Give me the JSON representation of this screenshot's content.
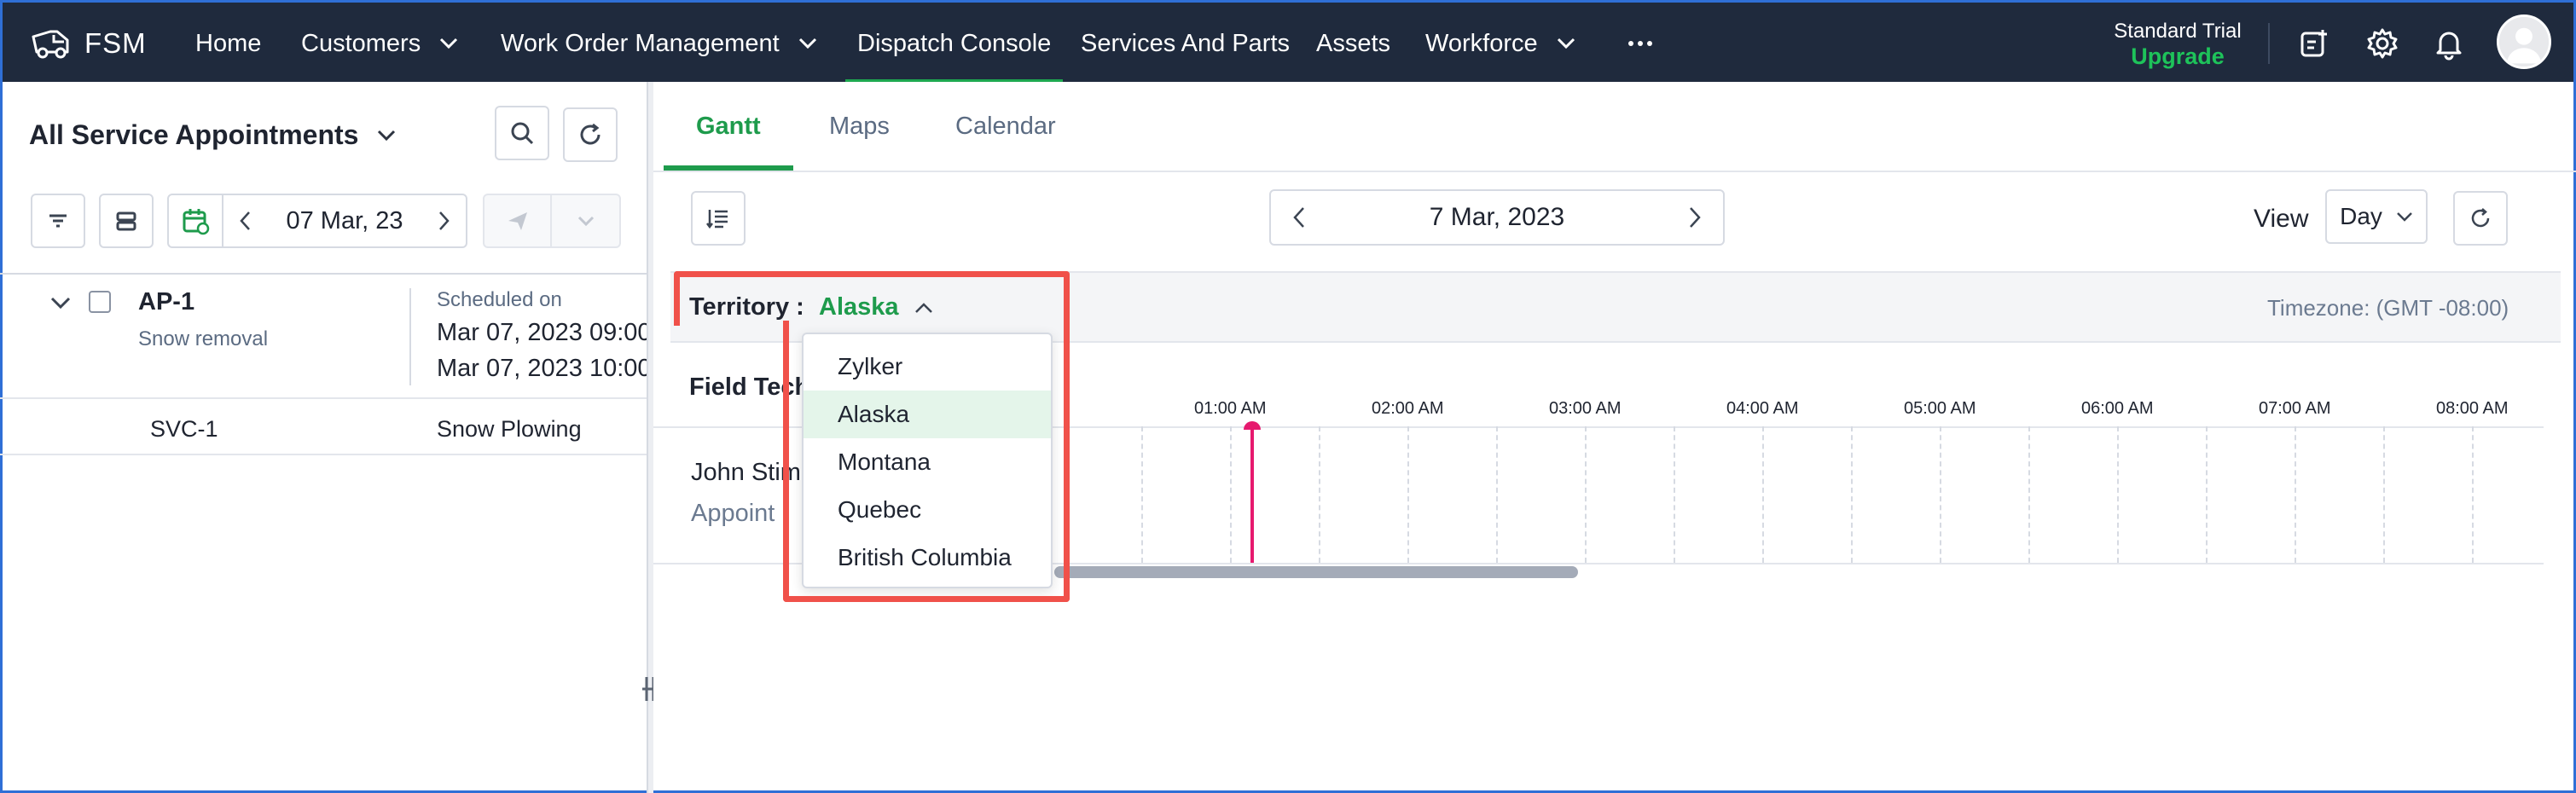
{
  "app": {
    "name": "FSM"
  },
  "nav": {
    "items": [
      {
        "label": "Home"
      },
      {
        "label": "Customers"
      },
      {
        "label": "Work Order Management"
      },
      {
        "label": "Dispatch Console"
      },
      {
        "label": "Services And Parts"
      },
      {
        "label": "Assets"
      },
      {
        "label": "Workforce"
      }
    ],
    "active": "Dispatch Console",
    "trial_label": "Standard Trial",
    "upgrade_label": "Upgrade",
    "icons": [
      "ellipsis-icon",
      "add-note-icon",
      "gear-icon",
      "bell-icon",
      "avatar"
    ]
  },
  "left_panel": {
    "title": "All Service Appointments",
    "date": "07 Mar, 23",
    "appointments": [
      {
        "id": "AP-1",
        "subtitle": "Snow removal",
        "scheduled_label": "Scheduled on",
        "scheduled_start": "Mar 07, 2023 09:00",
        "scheduled_end": "Mar 07, 2023 10:00",
        "service": {
          "id": "SVC-1",
          "name": "Snow Plowing"
        }
      }
    ]
  },
  "tabs": [
    {
      "label": "Gantt",
      "active": true
    },
    {
      "label": "Maps",
      "active": false
    },
    {
      "label": "Calendar",
      "active": false
    }
  ],
  "gantt": {
    "date": "7 Mar, 2023",
    "view_label": "View",
    "view_value": "Day",
    "territory_label": "Territory :",
    "territory_value": "Alaska",
    "timezone": "Timezone: (GMT -08:00)",
    "column_header": "Field Tech",
    "hours": [
      "01:00 AM",
      "02:00 AM",
      "03:00 AM",
      "04:00 AM",
      "05:00 AM",
      "06:00 AM",
      "07:00 AM",
      "08:00 AM"
    ],
    "tech_name": "John Stim",
    "tech_sub": "Appoint"
  },
  "territory_dropdown": {
    "options": [
      "Zylker",
      "Alaska",
      "Montana",
      "Quebec",
      "British Columbia"
    ],
    "selected": "Alaska"
  },
  "colors": {
    "nav_bg": "#1f2a3d",
    "accent_green": "#1e9b4c",
    "highlight_red": "#f0514a",
    "now_line": "#e6196e"
  }
}
